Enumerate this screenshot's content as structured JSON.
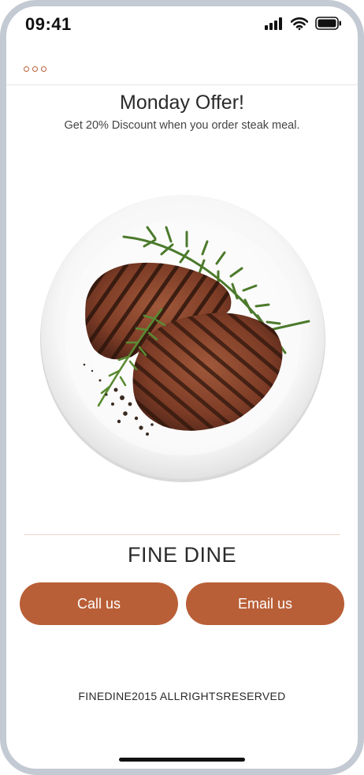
{
  "status_bar": {
    "time": "09:41",
    "icons": [
      "cellular-signal-icon",
      "wifi-icon",
      "battery-icon"
    ]
  },
  "nav": {
    "menu_icon": "more-dots-icon"
  },
  "offer": {
    "title": "Monday Offer!",
    "subtitle": "Get 20% Discount when you order steak meal."
  },
  "image": {
    "subject": "grilled-steak-plate"
  },
  "brand": {
    "name": "FINE DINE"
  },
  "actions": {
    "call_label": "Call us",
    "email_label": "Email us"
  },
  "footer": {
    "text": "FINEDINE2015 ALLRIGHTSRESERVED"
  },
  "colors": {
    "accent": "#b95f37",
    "divider": "#f3d6cc",
    "frame": "#c3cad3",
    "text": "#2a2a2a"
  }
}
